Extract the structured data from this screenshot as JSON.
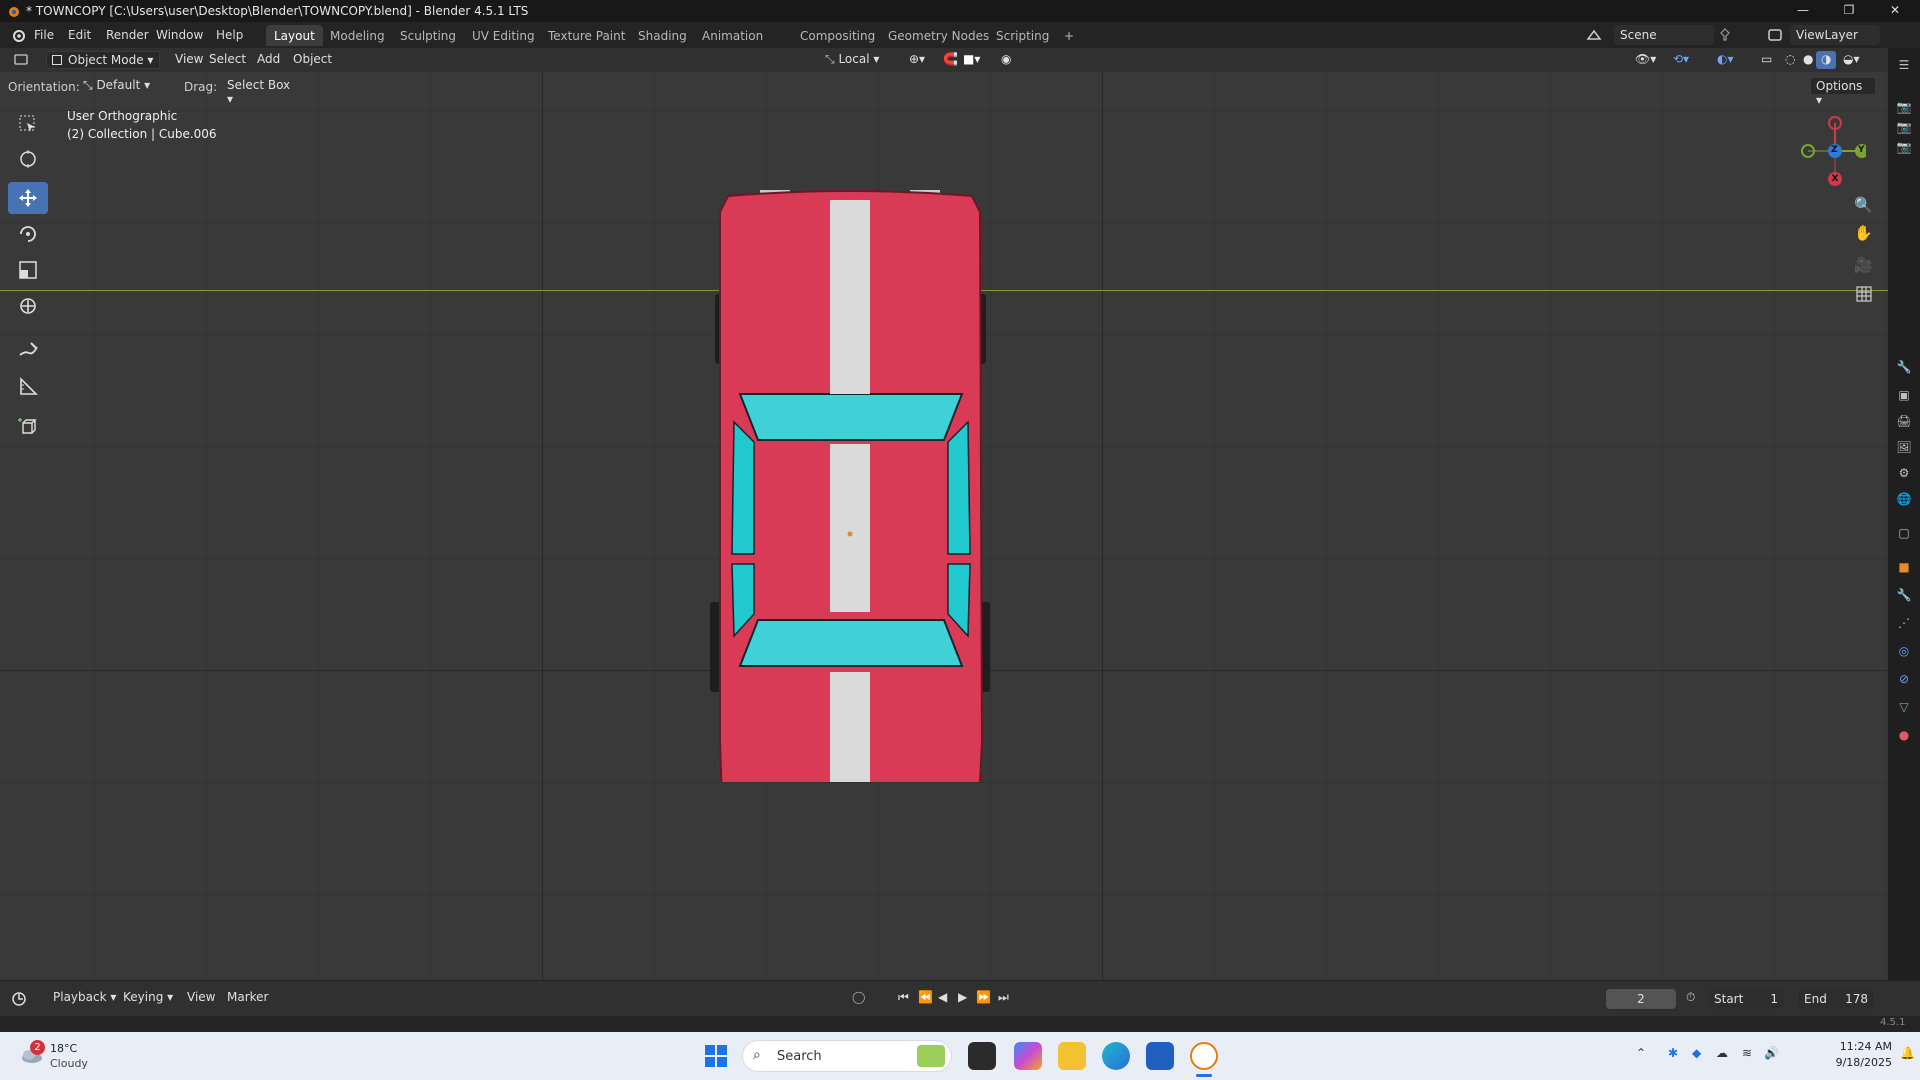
{
  "window": {
    "title": "* TOWNCOPY [C:\\Users\\user\\Desktop\\Blender\\TOWNCOPY.blend] - Blender 4.5.1 LTS",
    "controls": {
      "minimize": "—",
      "maximize": "❐",
      "close": "✕"
    }
  },
  "menu": [
    "File",
    "Edit",
    "Render",
    "Window",
    "Help"
  ],
  "workspaces": [
    "Layout",
    "Modeling",
    "Sculpting",
    "UV Editing",
    "Texture Paint",
    "Shading",
    "Animation",
    "Compositing",
    "Geometry Nodes",
    "Scripting"
  ],
  "active_workspace": "Layout",
  "add_workspace": "+",
  "scene": {
    "name": "Scene",
    "view_layer": "ViewLayer"
  },
  "header": {
    "mode": "Object Mode",
    "menus": [
      "View",
      "Select",
      "Add",
      "Object"
    ],
    "transform_orientation": "Local"
  },
  "tool_settings": {
    "orientation_label": "Orientation:",
    "orientation_value": "Default",
    "drag_label": "Drag:",
    "drag_value": "Select Box",
    "options": "Options"
  },
  "viewport": {
    "view_name": "User Orthographic",
    "collection_info": "(2) Collection | Cube.006"
  },
  "gizmo": {
    "x": "X",
    "y": "Y",
    "z": "Z"
  },
  "timeline": {
    "menus": [
      "Playback",
      "Keying",
      "View",
      "Marker"
    ],
    "current_frame": "2",
    "start_label": "Start",
    "start": "1",
    "end_label": "End",
    "end": "178"
  },
  "status": {
    "version": "4.5.1"
  },
  "taskbar": {
    "weather_temp": "18°C",
    "weather_desc": "Cloudy",
    "weather_badge": "2",
    "search": "Search",
    "time": "11:24 AM",
    "date": "9/18/2025"
  },
  "colors": {
    "accent": "#4772b3",
    "car_red": "#d93a55",
    "car_glass": "#3fd1d6",
    "car_stripe": "#dadada",
    "axis_x": "#d0394b",
    "axis_y": "#7aa42e",
    "axis_z": "#2f7ad6"
  }
}
